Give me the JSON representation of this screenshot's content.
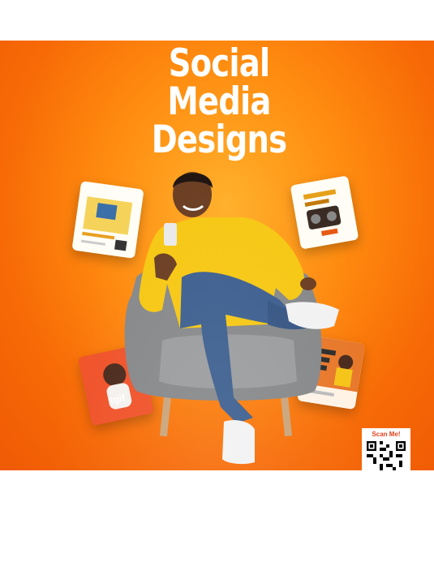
{
  "poster": {
    "title_lines": [
      "Social",
      "Media",
      "Designs"
    ],
    "scan_label": "Scan Me!"
  },
  "colors": {
    "background_orange": "#f76a06",
    "sweater_yellow": "#f8c80f",
    "jeans_blue": "#3d5f8f",
    "chair_gray": "#858789",
    "qr_label_red": "#e8401c"
  }
}
